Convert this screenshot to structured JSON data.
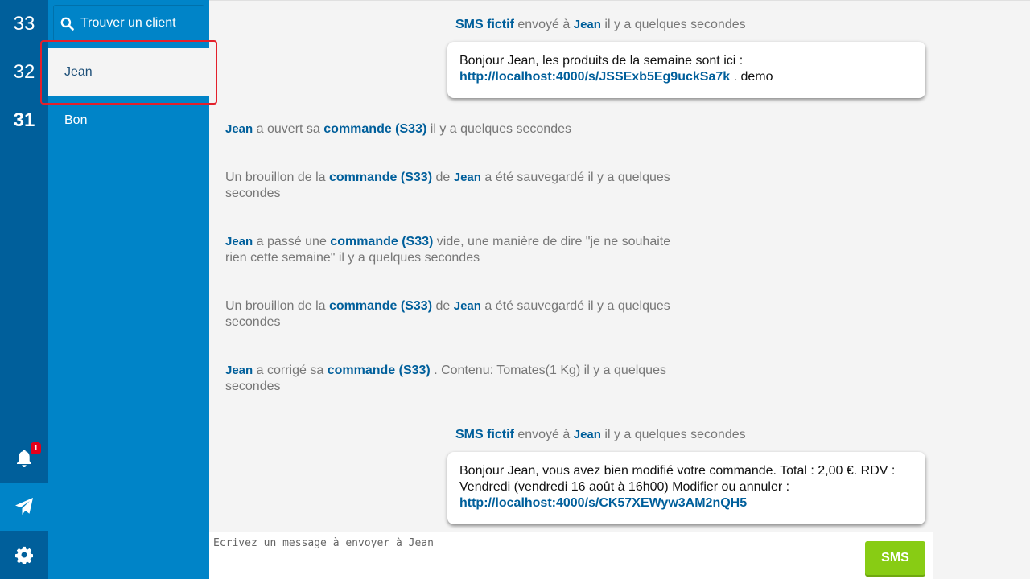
{
  "weeks": [
    "33",
    "32",
    "31"
  ],
  "notifications": {
    "count": "1"
  },
  "search": {
    "placeholder": "Trouver un client"
  },
  "clients": [
    {
      "name": "Jean"
    },
    {
      "name": "Bon"
    }
  ],
  "feed": {
    "sms1": {
      "title": "SMS fictif",
      "sent_to": "envoyé à",
      "name": "Jean",
      "time": "il y a quelques secondes",
      "body": "Bonjour Jean, les produits de la semaine sont ici :",
      "link": "http://localhost:4000/s/JSSExb5Eg9uckSa7k",
      "tail": ". demo"
    },
    "event1": {
      "name": "Jean",
      "text": "a ouvert sa",
      "order": "commande (S33)",
      "time": "il y a quelques secondes"
    },
    "event2": {
      "pre": "Un brouillon de la",
      "order": "commande (S33)",
      "de": "de",
      "name": "Jean",
      "post": "a été sauvegardé il y a quelques secondes"
    },
    "event3": {
      "name": "Jean",
      "text": "a passé une",
      "order": "commande (S33)",
      "post": "vide, une manière de dire \"je ne souhaite rien cette semaine\" il y a quelques secondes"
    },
    "event4": {
      "pre": "Un brouillon de la",
      "order": "commande (S33)",
      "de": "de",
      "name": "Jean",
      "post": "a été sauvegardé il y a quelques secondes"
    },
    "event5": {
      "name": "Jean",
      "text": "a corrigé sa",
      "order": "commande (S33)",
      "post": ". Contenu: Tomates(1 Kg) il y a quelques secondes"
    },
    "sms2": {
      "title": "SMS fictif",
      "sent_to": "envoyé à",
      "name": "Jean",
      "time": "il y a quelques secondes",
      "body": "Bonjour Jean, vous avez bien modifié votre commande. Total : 2,00 €. RDV : Vendredi (vendredi 16 août à 16h00) Modifier ou annuler :",
      "link": "http://localhost:4000/s/CK57XEWyw3AM2nQH5"
    }
  },
  "composer": {
    "placeholder": "Ecrivez un message à envoyer à Jean",
    "send_label": "SMS"
  },
  "colors": {
    "rail": "#005f9b",
    "panel": "#0084c8",
    "accent": "#005f9b",
    "send_button": "#88cc14",
    "badge": "#e3001b"
  }
}
